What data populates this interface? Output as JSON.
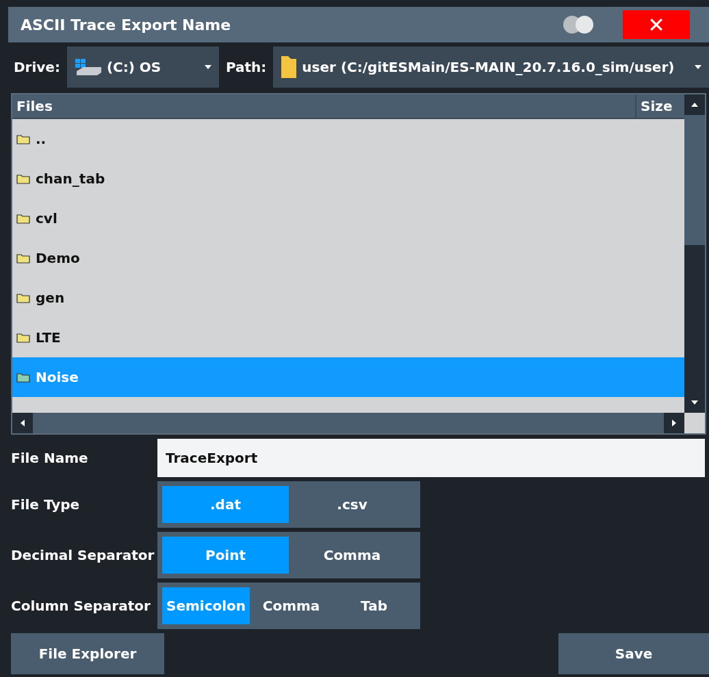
{
  "window": {
    "title": "ASCII Trace Export Name",
    "close": "✕"
  },
  "drive": {
    "label": "Drive:",
    "value": "(C:) OS"
  },
  "path": {
    "label": "Path:",
    "value": "user (C:/gitESMain/ES-MAIN_20.7.16.0_sim/user)"
  },
  "files": {
    "columns": [
      "Files",
      "Size"
    ],
    "rows": [
      {
        "name": "..",
        "selected": false
      },
      {
        "name": "chan_tab",
        "selected": false
      },
      {
        "name": "cvl",
        "selected": false
      },
      {
        "name": "Demo",
        "selected": false
      },
      {
        "name": "gen",
        "selected": false
      },
      {
        "name": "LTE",
        "selected": false
      },
      {
        "name": "Noise",
        "selected": true
      }
    ]
  },
  "file_name": {
    "label": "File Name",
    "value": "TraceExport"
  },
  "options": [
    {
      "label": "File Type",
      "choices": [
        {
          "label": ".dat",
          "selected": true
        },
        {
          "label": ".csv",
          "selected": false
        }
      ]
    },
    {
      "label": "Decimal Separator",
      "choices": [
        {
          "label": "Point",
          "selected": true
        },
        {
          "label": "Comma",
          "selected": false
        }
      ]
    },
    {
      "label": "Column Separator",
      "choices": [
        {
          "label": "Semicolon",
          "selected": true
        },
        {
          "label": "Comma",
          "selected": false
        },
        {
          "label": "Tab",
          "selected": false
        }
      ]
    }
  ],
  "buttons": [
    "File Explorer",
    "Save"
  ]
}
